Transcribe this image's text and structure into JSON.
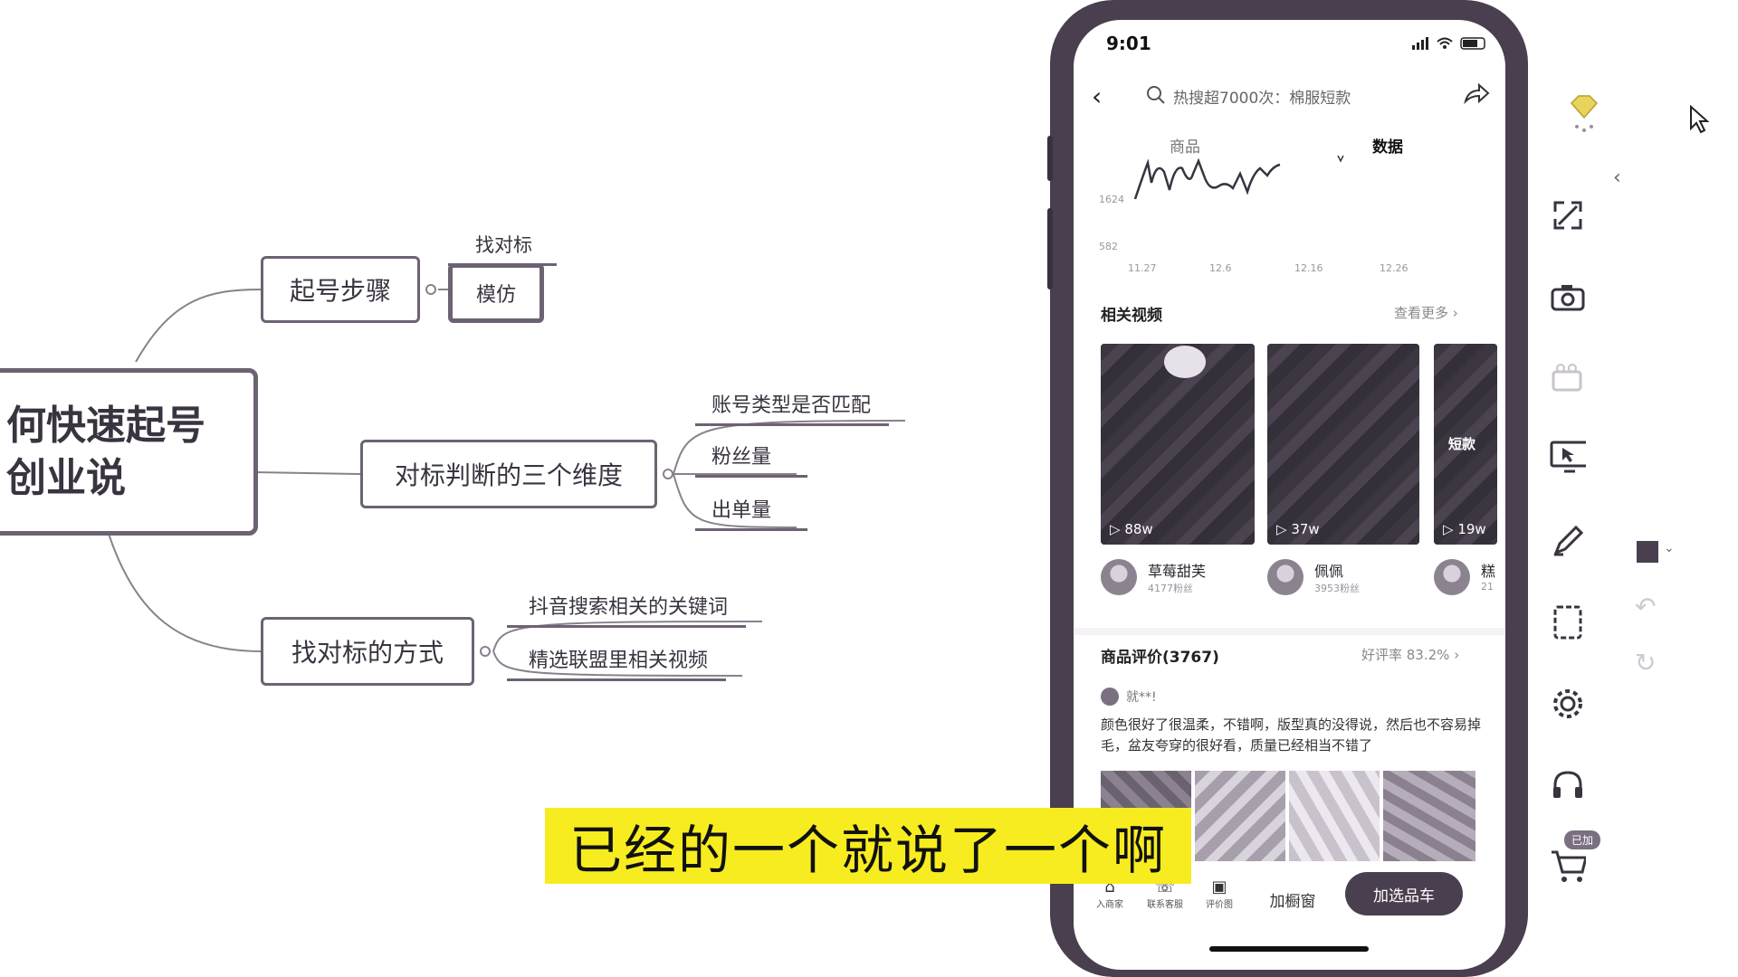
{
  "mindmap": {
    "root_line1": "何快速起号",
    "root_line2": "创业说",
    "branch1": {
      "label": "起号步骤",
      "child_heading": "找对标",
      "child": "模仿"
    },
    "branch2": {
      "label": "对标判断的三个维度",
      "children": [
        "账号类型是否匹配",
        "粉丝量",
        "出单量"
      ]
    },
    "branch3": {
      "label": "找对标的方式",
      "children": [
        "抖音搜索相关的关键词",
        "精选联盟里相关视频"
      ]
    }
  },
  "phone": {
    "time": "9:01",
    "search_text": "热搜超7000次：棉服短款",
    "tabs": [
      "商品",
      "数据"
    ],
    "chart_data": {
      "type": "line",
      "y_ticks": [
        "1624",
        "582"
      ],
      "x_ticks": [
        "11.27",
        "12.6",
        "12.16",
        "12.26"
      ]
    },
    "related_videos": {
      "title": "相关视频",
      "more": "查看更多 ›",
      "videos": [
        {
          "views": "88w",
          "creator": "草莓甜芙",
          "fans": "4177粉丝"
        },
        {
          "views": "37w",
          "creator": "佩佩",
          "fans": "3953粉丝"
        },
        {
          "views": "19w",
          "creator": "糕",
          "fans": "21",
          "badge": "短款"
        }
      ]
    },
    "reviews": {
      "title": "商品评价(3767)",
      "rate": "好评率 83.2% ›",
      "user": "就**!",
      "text": "颜色很好了很温柔，不错啊，版型真的没得说，然后也不容易掉毛，盆友夸穿的很好看，质量已经相当不错了"
    },
    "bottom_bar": {
      "icons": [
        "入商家",
        "联系客服",
        "评价图"
      ],
      "add_window": "加橱窗",
      "add_selection": "加选品车"
    }
  },
  "subtitle": "已经的一个就说了一个啊",
  "toolbar": {
    "cart_badge": "已加"
  }
}
